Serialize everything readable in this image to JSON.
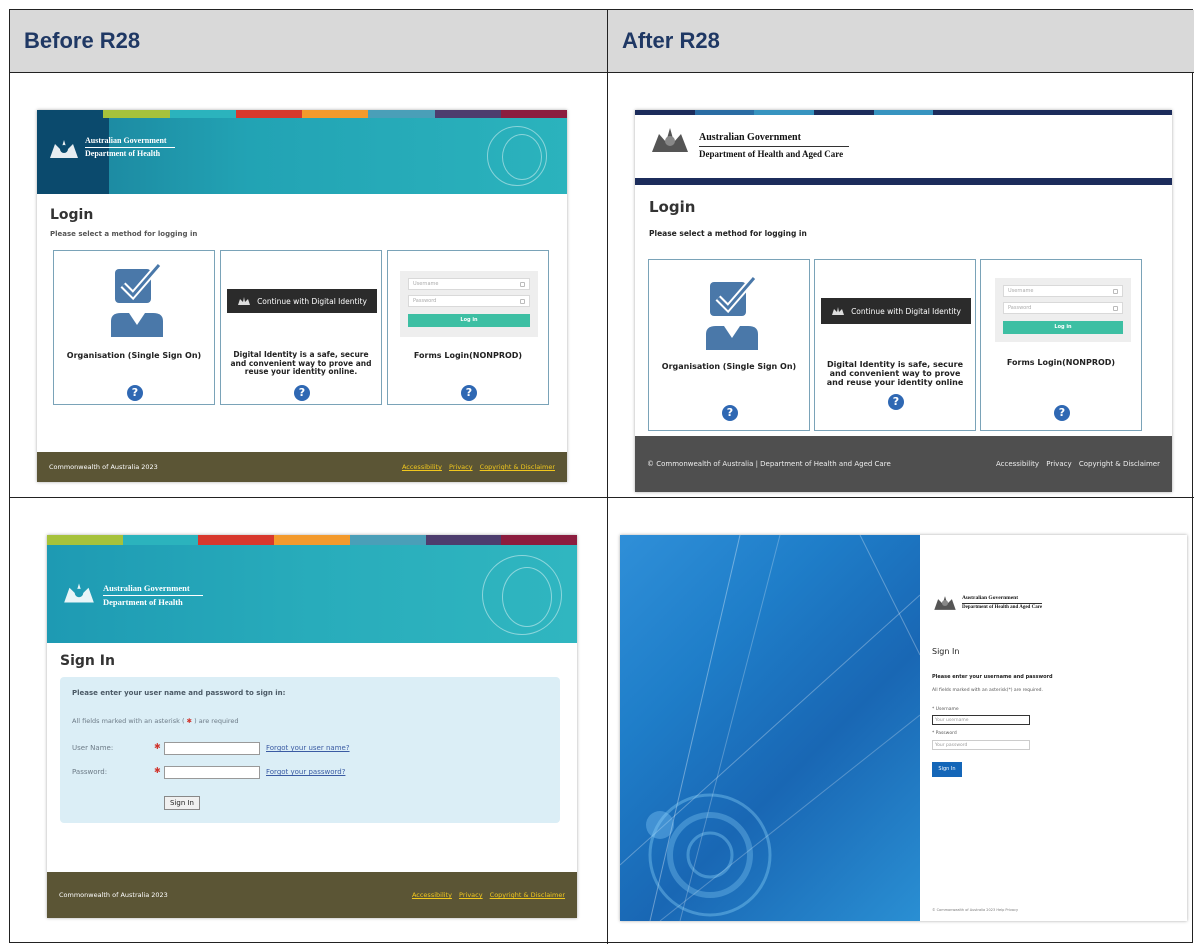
{
  "headers": {
    "before": "Before R28",
    "after": "After R28"
  },
  "colorbar": [
    "#0b4a6d",
    "#a6c23b",
    "#2bb3bd",
    "#d8382d",
    "#f39a2c",
    "#4a9fb8",
    "#4d3d6e",
    "#8c1d3f"
  ],
  "old_login": {
    "gov": "Australian Government",
    "dept": "Department of Health",
    "title": "Login",
    "subtitle": "Please select a method for logging in",
    "sso_label": "Organisation (Single Sign On)",
    "di_button": "Continue with Digital Identity",
    "di_label": "Digital Identity is a safe, secure and convenient way to prove and reuse your identity online.",
    "username_ph": "Username",
    "password_ph": "Password",
    "login_btn": "Log in",
    "forms_label": "Forms Login(NONPROD)",
    "help": "?",
    "footer_left": "Commonwealth of Australia 2023",
    "footer_links": [
      "Accessibility",
      "Privacy",
      "Copyright & Disclaimer"
    ]
  },
  "new_login": {
    "gov": "Australian Government",
    "dept": "Department of Health and Aged Care",
    "title": "Login",
    "subtitle": "Please select a method for logging in",
    "sso_label": "Organisation (Single Sign On)",
    "di_button": "Continue with Digital Identity",
    "di_label": "Digital Identity is safe, secure and convenient way to prove and reuse your identity online",
    "username_ph": "Username",
    "password_ph": "Password",
    "login_btn": "Log in",
    "forms_label": "Forms Login(NONPROD)",
    "help": "?",
    "footer_left": "© Commonwealth of Australia | Department of Health and Aged Care",
    "footer_links": [
      "Accessibility",
      "Privacy",
      "Copyright & Disclaimer"
    ]
  },
  "old_signin": {
    "gov": "Australian Government",
    "dept": "Department of Health",
    "title": "Sign In",
    "prompt": "Please enter your user name and password to sign in:",
    "required_note_pre": "All fields marked with an asterisk (",
    "required_star": "✱",
    "required_note_post": ") are required",
    "username_label": "User Name:",
    "password_label": "Password:",
    "forgot_user": "Forgot your user name?",
    "forgot_pass": "Forgot your password?",
    "button": "Sign In",
    "footer_left": "Commonwealth of Australia 2023",
    "footer_links": [
      "Accessibility",
      "Privacy",
      "Copyright & Disclaimer"
    ]
  },
  "new_signin": {
    "gov": "Australian Government",
    "dept": "Department of Health and Aged Care",
    "title": "Sign In",
    "prompt": "Please enter your username and password",
    "required_note": "All fields marked with an asterisk(*) are required.",
    "username_label": "* Username",
    "username_ph": "Your username",
    "password_label": "* Password",
    "password_ph": "Your password",
    "button": "Sign In",
    "footer": "© Commonwealth of Australia 2023   Help   Privacy"
  }
}
